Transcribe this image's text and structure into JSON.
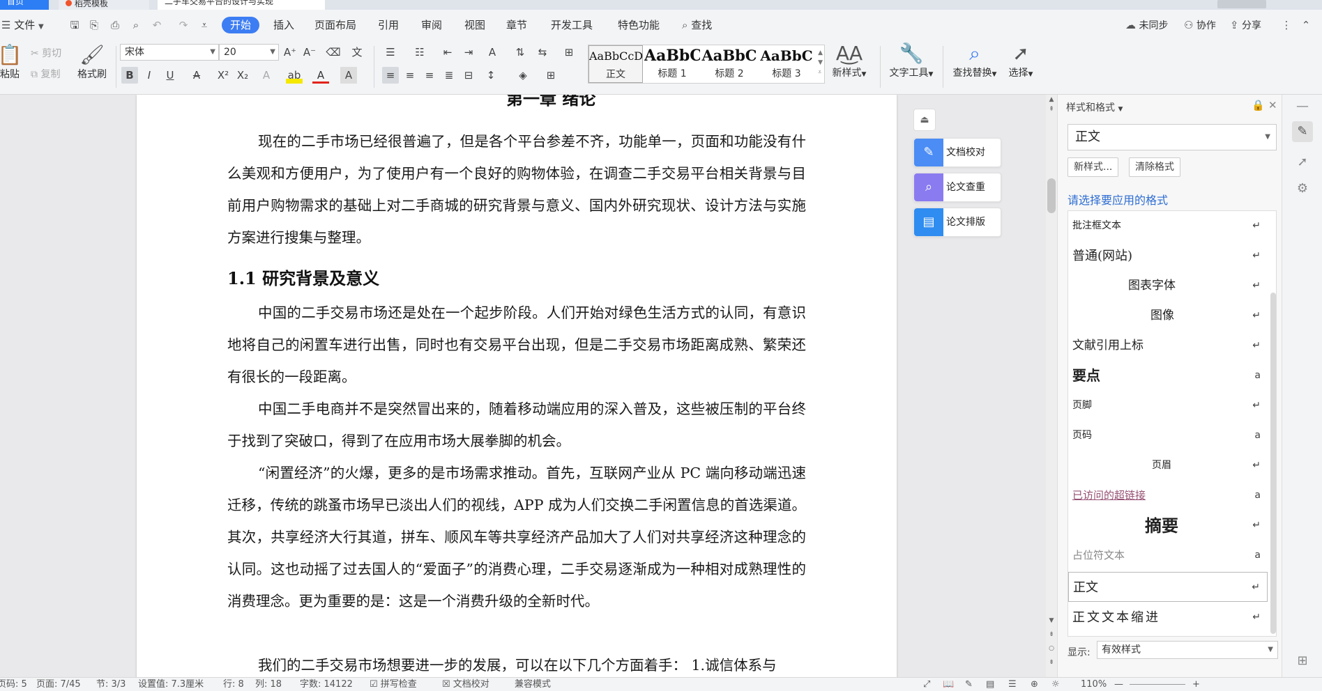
{
  "tabs": {
    "home": "首页",
    "tab1": "稻壳模板",
    "tab2": "二手车交易平台的设计与实现"
  },
  "menu": {
    "file": "文件",
    "items": [
      "开始",
      "插入",
      "页面布局",
      "引用",
      "审阅",
      "视图",
      "章节",
      "开发工具",
      "特色功能"
    ],
    "search": "查找",
    "sync": "未同步",
    "collab": "协作",
    "share": "分享"
  },
  "ribbon": {
    "paste": "粘贴",
    "cut": "剪切",
    "copy": "复制",
    "format_painter": "格式刷",
    "font_name": "宋体",
    "font_size": "20",
    "styles": [
      {
        "sample": "AaBbCcDd",
        "name": "正文"
      },
      {
        "sample": "AaBbC",
        "name": "标题 1"
      },
      {
        "sample": "AaBbC",
        "name": "标题 2"
      },
      {
        "sample": "AaBbC",
        "name": "标题 3"
      }
    ],
    "new_style": "新样式",
    "text_tools": "文字工具",
    "find_replace": "查找替换",
    "select": "选择"
  },
  "document": {
    "top_heading": "第一章 绪论",
    "p1": "现在的二手市场已经很普遍了，但是各个平台参差不齐，功能单一，页面和功能没有什么美观和方便用户，为了使用户有一个良好的购物体验，在调查二手交易平台相关背景与目前用户购物需求的基础上对二手商城的研究背景与意义、国内外研究现状、设计方法与实施方案进行搜集与整理。",
    "h2": "1.1  研究背景及意义",
    "p2": "中国的二手交易市场还是处在一个起步阶段。人们开始对绿色生活方式的认同，有意识地将自己的闲置车进行出售，同时也有交易平台出现，但是二手交易市场距离成熟、繁荣还有很长的一段距离。",
    "p3": "中国二手电商并不是突然冒出来的，随着移动端应用的深入普及，这些被压制的平台终于找到了突破口，得到了在应用市场大展拳脚的机会。",
    "p4": "“闲置经济”的火爆，更多的是市场需求推动。首先，互联网产业从 PC 端向移动端迅速迁移，传统的跳蚤市场早已淡出人们的视线，APP 成为人们交换二手闲置信息的首选渠道。其次，共享经济大行其道，拼车、顺风车等共享经济产品加大了人们对共享经济这种理念的认同。这也动摇了过去国人的“爱面子”的消费心理，二手交易逐渐成为一种相对成熟理性的消费理念。更为重要的是：这是一个消费升级的全新时代。",
    "p5": "我们的二手交易市场想要进一步的发展，可以在以下几个方面着手：  1.诚信体系与"
  },
  "float_tools": [
    "文档校对",
    "论文查重",
    "论文排版"
  ],
  "pane": {
    "title": "样式和格式",
    "current": "正文",
    "new_btn": "新样式...",
    "clear_btn": "清除格式",
    "hint": "请选择要应用的格式",
    "styles": [
      {
        "name": "批注框文本",
        "mark": "↵"
      },
      {
        "name": "普通(网站)",
        "mark": "↵"
      },
      {
        "name": "图表字体",
        "mark": "↵"
      },
      {
        "name": "图像",
        "mark": "↵"
      },
      {
        "name": "文献引用上标",
        "mark": "↵"
      },
      {
        "name": "要点",
        "mark": "a"
      },
      {
        "name": "页脚",
        "mark": "↵"
      },
      {
        "name": "页码",
        "mark": "a"
      },
      {
        "name": "页眉",
        "mark": "↵"
      },
      {
        "name": "已访问的超链接",
        "mark": "a"
      },
      {
        "name": "摘要",
        "mark": "↵"
      },
      {
        "name": "占位符文本",
        "mark": "a"
      },
      {
        "name": "正文",
        "mark": "↵"
      },
      {
        "name": "正文文本缩进",
        "mark": "↵"
      }
    ],
    "show_label": "显示:",
    "show_value": "有效样式"
  },
  "status": {
    "page_code": "页码: 5",
    "pages": "页面: 7/45",
    "section": "节: 3/3",
    "setting": "设置值: 7.3厘米",
    "row": "行: 8",
    "col": "列: 18",
    "words": "字数: 14122",
    "spell": "拼写检查",
    "proof": "文档校对",
    "compat": "兼容模式",
    "zoom": "110%"
  }
}
